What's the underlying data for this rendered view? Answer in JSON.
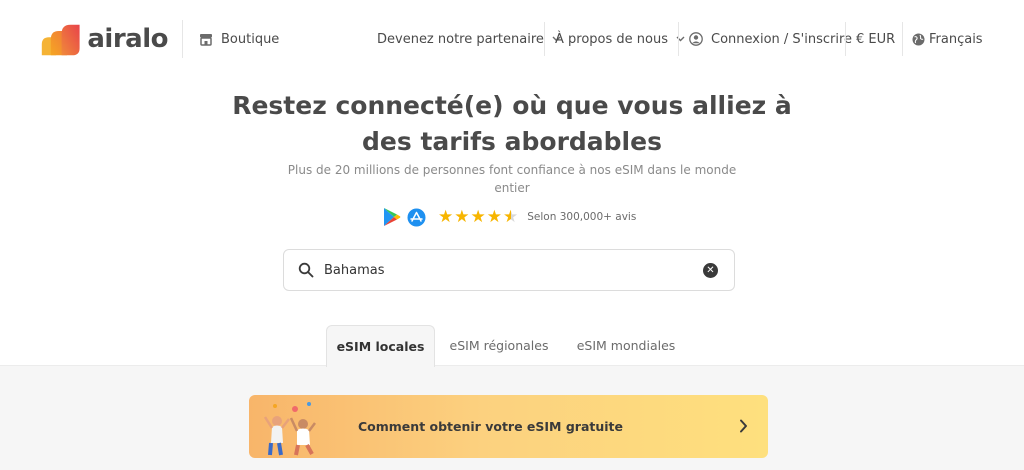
{
  "brand": {
    "name": "airalo"
  },
  "nav": {
    "shop_label": "Boutique",
    "partner_label": "Devenez notre partenaire",
    "about_label": "À propos de nous",
    "login_label": "Connexion / S'inscrire",
    "currency_label": "€ EUR",
    "language_label": "Français"
  },
  "hero": {
    "title_line1": "Restez connecté(e) où que vous alliez à",
    "title_line2": "des tarifs abordables",
    "subtitle_line1": "Plus de 20 millions de personnes font confiance à nos eSIM dans le monde",
    "subtitle_line2": "entier",
    "rating_value": 4.5,
    "rating_max": 5,
    "rating_text": "Selon 300,000+ avis"
  },
  "search": {
    "value": "Bahamas",
    "placeholder": ""
  },
  "tabs": [
    {
      "label": "eSIM locales",
      "active": true
    },
    {
      "label": "eSIM régionales",
      "active": false
    },
    {
      "label": "eSIM mondiales",
      "active": false
    }
  ],
  "promo": {
    "label": "Comment obtenir votre eSIM gratuite"
  },
  "colors": {
    "star": "#f7b500",
    "logo_orange": "#f5a623",
    "logo_red": "#e8434a",
    "promo_start": "#f8b56a",
    "promo_end": "#fee07e"
  },
  "icons": [
    "store-icon",
    "chevron-down-icon",
    "user-circle-icon",
    "globe-icon",
    "google-play-icon",
    "app-store-icon",
    "search-icon",
    "clear-icon",
    "chevron-right-icon"
  ]
}
